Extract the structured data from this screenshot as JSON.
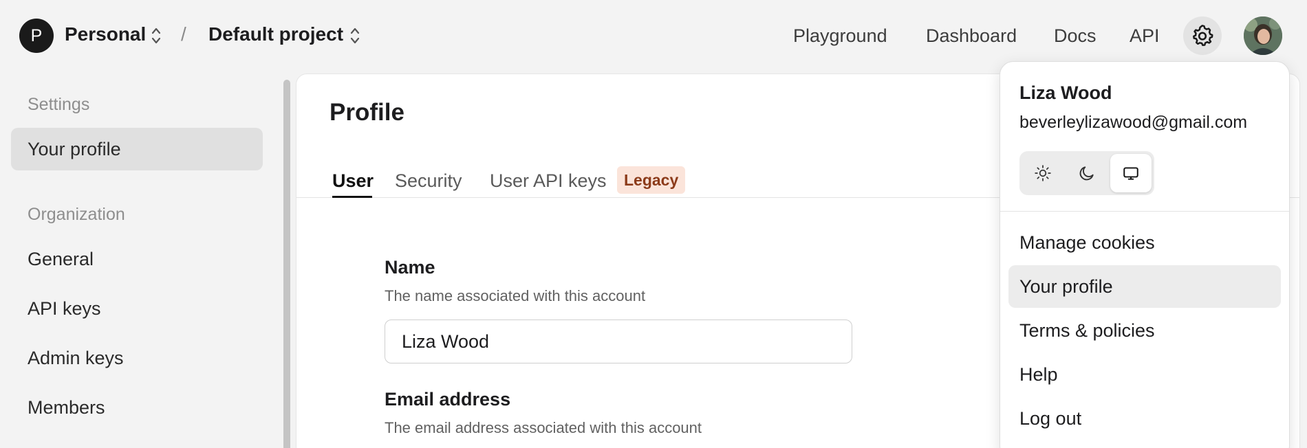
{
  "header": {
    "org_initial": "P",
    "org_name": "Personal",
    "separator": "/",
    "project_name": "Default project",
    "nav": [
      "Playground",
      "Dashboard",
      "Docs",
      "API"
    ]
  },
  "sidebar": {
    "settings_heading": "Settings",
    "profile_item": "Your profile",
    "org_heading": "Organization",
    "items": [
      "General",
      "API keys",
      "Admin keys",
      "Members"
    ]
  },
  "main": {
    "title": "Profile",
    "tabs": [
      "User",
      "Security",
      "User API keys"
    ],
    "legacy_badge": "Legacy",
    "name_label": "Name",
    "name_help": "The name associated with this account",
    "name_value": "Liza Wood",
    "email_label": "Email address",
    "email_help": "The email address associated with this account"
  },
  "user_menu": {
    "name": "Liza Wood",
    "email": "beverleylizawood@gmail.com",
    "theme_selected": "system",
    "items": [
      "Manage cookies",
      "Your profile",
      "Terms & policies",
      "Help",
      "Log out"
    ]
  },
  "colors": {
    "background": "#f3f3f3",
    "legacy_badge_bg": "#fbe4da",
    "legacy_badge_text": "#8c3b1a"
  }
}
